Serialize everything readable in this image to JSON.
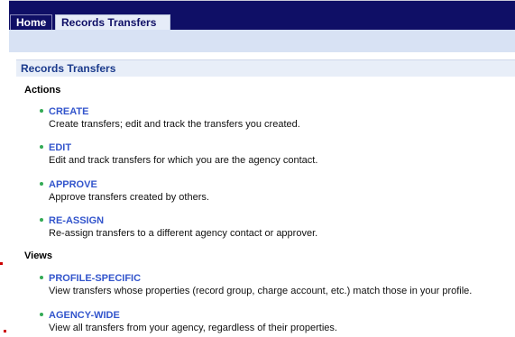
{
  "tabs": [
    {
      "label": "Home",
      "active": true
    },
    {
      "label": "Records Transfers",
      "active": false
    }
  ],
  "panel": {
    "title": "Records Transfers",
    "sections": [
      {
        "heading": "Actions",
        "items": [
          {
            "label": "CREATE",
            "description": "Create transfers; edit and track the transfers you created."
          },
          {
            "label": "EDIT",
            "description": "Edit and track transfers for which you are the agency contact."
          },
          {
            "label": "APPROVE",
            "description": "Approve transfers created by others."
          },
          {
            "label": "RE-ASSIGN",
            "description": "Re-assign transfers to a different agency contact or approver."
          }
        ]
      },
      {
        "heading": "Views",
        "items": [
          {
            "label": "PROFILE-SPECIFIC",
            "description": "View transfers whose properties (record group, charge account, etc.) match those in your profile."
          },
          {
            "label": "AGENCY-WIDE",
            "description": "View all transfers from your agency, regardless of their properties."
          }
        ]
      }
    ]
  },
  "colors": {
    "nav": "#0f0f66",
    "subbar": "#d8e2f4",
    "link": "#3355cc",
    "bullet": "#33aa55"
  }
}
